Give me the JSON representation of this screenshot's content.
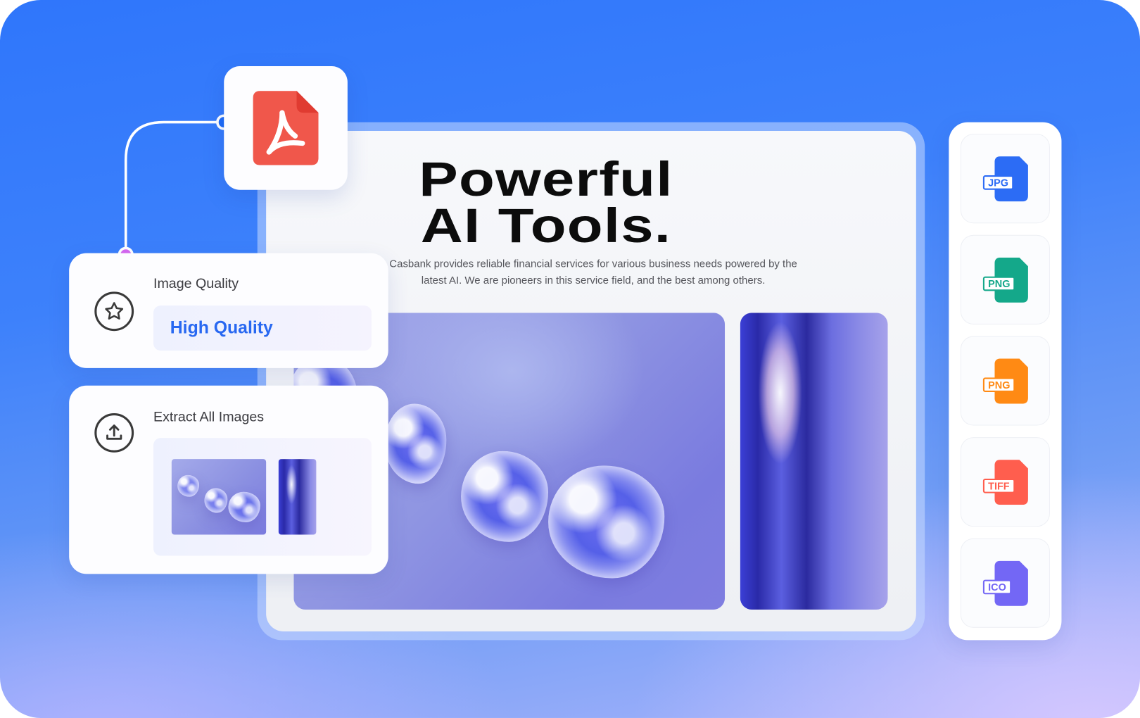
{
  "hero": {
    "title_line1": "Powerful",
    "title_line2": "AI Tools.",
    "description": "Casbank provides reliable financial services for various business needs powered by the latest AI. We are pioneers in this service field, and the best among others."
  },
  "source_file": {
    "icon": "pdf-icon",
    "color": "#f0574b"
  },
  "options": {
    "quality": {
      "label": "Image Quality",
      "value": "High Quality",
      "icon": "star-icon"
    },
    "extract": {
      "label": "Extract All Images",
      "icon": "upload-icon"
    }
  },
  "formats": [
    {
      "label": "JPG",
      "color": "#2c6cf5"
    },
    {
      "label": "PNG",
      "color": "#14a88a"
    },
    {
      "label": "PNG",
      "color": "#ff8a14"
    },
    {
      "label": "TIFF",
      "color": "#ff5e4e"
    },
    {
      "label": "ICO",
      "color": "#7367f5"
    }
  ],
  "connector": {
    "start_dot_color": "#1f6cf7",
    "end_dot_color": "#d767f0"
  }
}
